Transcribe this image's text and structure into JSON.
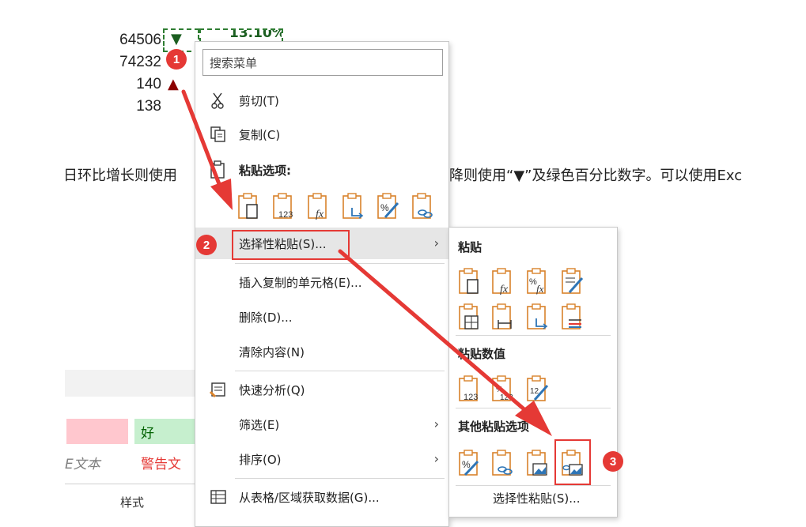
{
  "cells": {
    "values": [
      "64506",
      "74232",
      "140",
      "138"
    ],
    "down_symbol": "▼",
    "up_symbol": "▲",
    "percent_partial": "13.10%"
  },
  "paragraph": {
    "left": "日环比增长则使用",
    "right": "降则使用“▼”及绿色百分比数字。可以使用Exc"
  },
  "styles": {
    "good": "好",
    "explain": "E文本",
    "warning": "警告文",
    "group_label": "样式"
  },
  "context_menu": {
    "search_placeholder": "搜索菜单",
    "cut": "剪切(T)",
    "copy": "复制(C)",
    "paste_options": "粘贴选项:",
    "paste_special": "选择性粘贴(S)...",
    "insert_copied": "插入复制的单元格(E)...",
    "delete": "删除(D)...",
    "clear": "清除内容(N)",
    "quick_analysis": "快速分析(Q)",
    "filter": "筛选(E)",
    "sort": "排序(O)",
    "from_table": "从表格/区域获取数据(G)..."
  },
  "submenu": {
    "paste": "粘贴",
    "paste_values": "粘贴数值",
    "other_paste": "其他粘贴选项",
    "paste_special": "选择性粘贴(S)..."
  },
  "badges": [
    "1",
    "2",
    "3"
  ],
  "colors": {
    "accent_red": "#e53935",
    "down_green": "#1b5e20",
    "up_red": "#8b0000",
    "good_fill": "#c6efce",
    "bad_fill": "#ffc7ce",
    "icon_orange": "#d9822b",
    "icon_blue": "#2e75b6"
  }
}
